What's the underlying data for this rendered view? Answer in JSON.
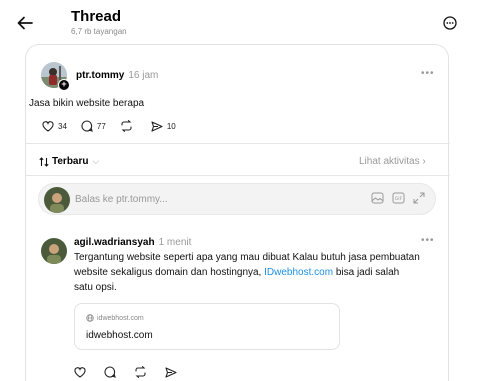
{
  "header": {
    "title": "Thread",
    "subtitle": "6,7 rb tayangan"
  },
  "post": {
    "username": "ptr.tommy",
    "time": "16 jam",
    "text": "Jasa bikin website berapa",
    "likes": "34",
    "comments": "77",
    "shares": "10"
  },
  "sort": {
    "label": "Terbaru",
    "activity_label": "Lihat aktivitas"
  },
  "reply": {
    "placeholder": "Balas ke ptr.tommy..."
  },
  "comment": {
    "username": "agil.wadriansyah",
    "time": "1 menit",
    "text_line1": "Tergantung website seperti apa yang mau dibuat Kalau butuh jasa pembuatan",
    "text_line2_pre": "website sekaligus domain dan hostingnya, ",
    "text_link": "IDwebhost.com",
    "text_line2_post": " bisa jadi salah",
    "text_line3": "satu opsi.",
    "link_domain": "idwebhost.com",
    "link_title": "idwebhost.com"
  },
  "colors": {
    "accent_link": "#1d8fe1",
    "muted": "#999999"
  }
}
